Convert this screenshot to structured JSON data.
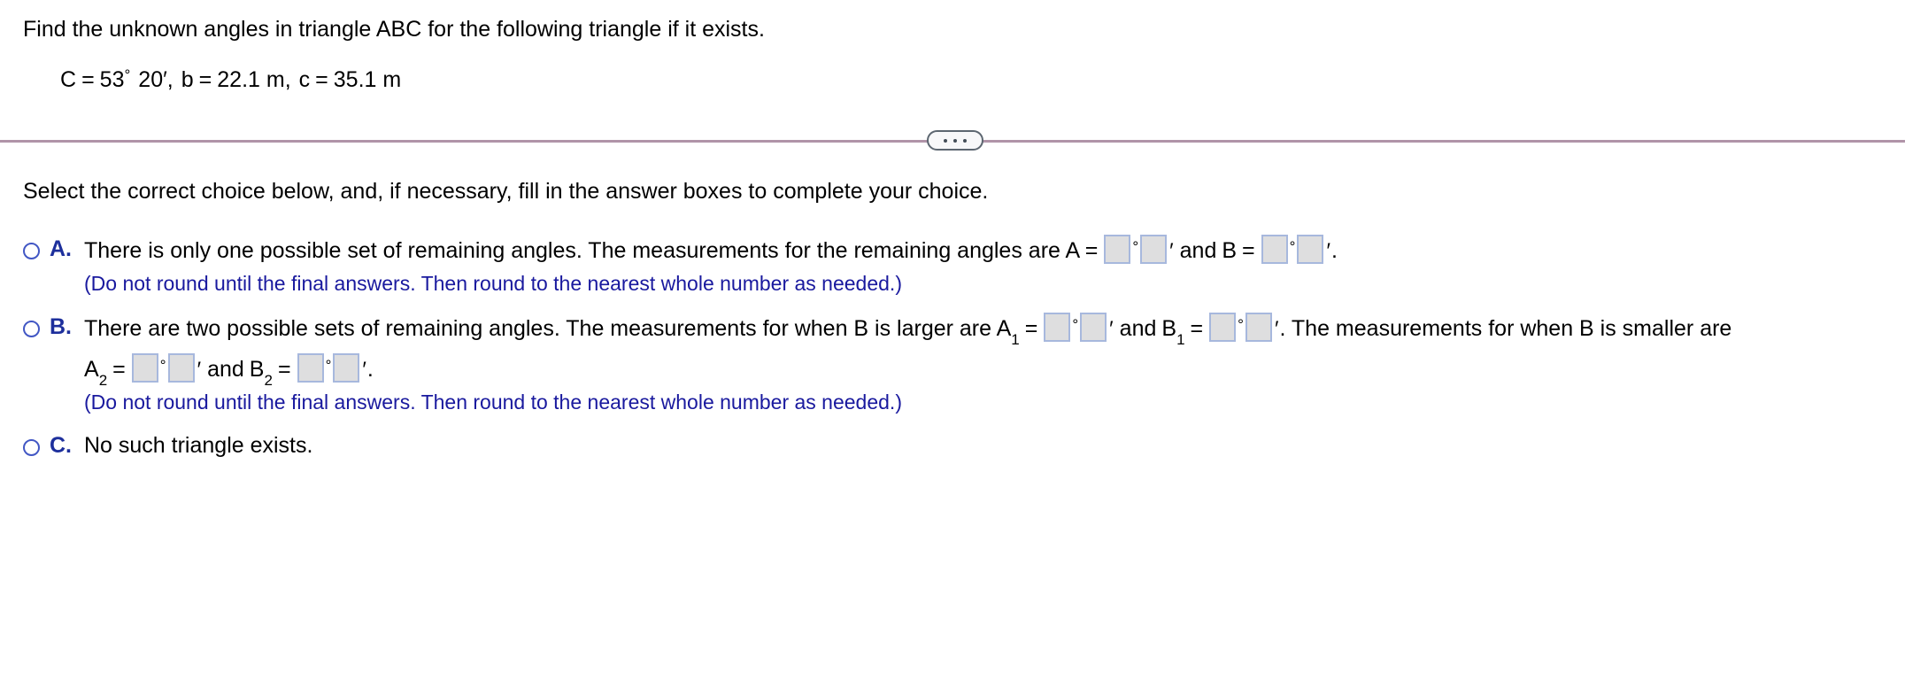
{
  "problem": {
    "statement": "Find the unknown angles in triangle ABC for the following triangle if it exists.",
    "given": {
      "angle_label": "C",
      "equals": "=",
      "angle_degrees": "53",
      "degree_symbol": "°",
      "angle_minutes": "20",
      "minute_symbol": "′",
      "comma1": ",",
      "side_b_label": "b",
      "side_b_value": "22.1 m",
      "comma2": ",",
      "side_c_label": "c",
      "side_c_value": "35.1 m",
      "full_text": "C = 53° 20′, b = 22.1 m, c = 35.1 m"
    }
  },
  "divider": {
    "more_options_icon": "ellipsis-icon",
    "line_color": "#b094a8",
    "dots": [
      "•",
      "•",
      "•"
    ]
  },
  "instruction": "Select the correct choice below, and, if necessary, fill in the answer boxes to complete your choice.",
  "choices": [
    {
      "id": "A",
      "letter": "A.",
      "selected": false,
      "text_before_A": "There is only one possible set of remaining angles. The measurements for the remaining angles are A =",
      "var_A_label": "A",
      "var_B_label": "B",
      "equals": "=",
      "and": "and",
      "degree_symbol": "°",
      "minute_symbol": "′",
      "period": ".",
      "note": "(Do not round until the final answers. Then round to the nearest whole number as needed.)",
      "boxes": [
        {
          "name": "A-degrees",
          "value": ""
        },
        {
          "name": "A-minutes",
          "value": ""
        },
        {
          "name": "B-degrees",
          "value": ""
        },
        {
          "name": "B-minutes",
          "value": ""
        }
      ]
    },
    {
      "id": "B",
      "letter": "B.",
      "selected": false,
      "text_line1_lead": "There are two possible sets of remaining angles. The measurements for when B is larger are A",
      "sub1": "1",
      "sub2": "2",
      "equals": "=",
      "and": "and",
      "var_B1_label": "B",
      "var_A2_label": "A",
      "var_B2_label": "B",
      "degree_symbol": "°",
      "minute_symbol": "′",
      "period": ".",
      "text_line1_tail": ". The measurements for when B is smaller are",
      "note": "(Do not round until the final answers. Then round to the nearest whole number as needed.)",
      "boxes": [
        {
          "name": "A1-degrees",
          "value": ""
        },
        {
          "name": "A1-minutes",
          "value": ""
        },
        {
          "name": "B1-degrees",
          "value": ""
        },
        {
          "name": "B1-minutes",
          "value": ""
        },
        {
          "name": "A2-degrees",
          "value": ""
        },
        {
          "name": "A2-minutes",
          "value": ""
        },
        {
          "name": "B2-degrees",
          "value": ""
        },
        {
          "name": "B2-minutes",
          "value": ""
        }
      ]
    },
    {
      "id": "C",
      "letter": "C.",
      "selected": false,
      "text": "No such triangle exists."
    }
  ],
  "colors": {
    "choice_letter": "#1d2f9c",
    "note_blue": "#19199e",
    "radio_border": "#4257c4",
    "answer_box_fill": "#dededf",
    "answer_box_border": "#a7b8dd",
    "divider": "#b094a8"
  }
}
